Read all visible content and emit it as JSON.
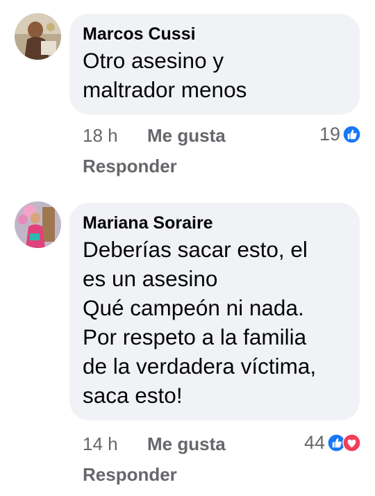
{
  "comments": [
    {
      "author": "Marcos Cussi",
      "lines": [
        "Otro asesino y",
        "maltrador menos"
      ],
      "time": "18 h",
      "like_label": "Me gusta",
      "reply_label": "Responder",
      "reaction_count": "19",
      "reaction_icons": [
        "like-icon"
      ]
    },
    {
      "author": "Mariana Soraire",
      "lines": [
        "Deberías sacar esto, el",
        "es un asesino",
        "Qué campeón ni nada.",
        "Por respeto a la familia",
        "de la verdadera víctima,",
        "saca esto!"
      ],
      "time": "14 h",
      "like_label": "Me gusta",
      "reply_label": "Responder",
      "reaction_count": "44",
      "reaction_icons": [
        "like-icon",
        "love-icon"
      ]
    }
  ],
  "colors": {
    "bubble": "#f0f2f5",
    "text": "#050505",
    "meta": "#65676b",
    "like_blue": "#1877f2",
    "love_red": "#f33e58"
  }
}
